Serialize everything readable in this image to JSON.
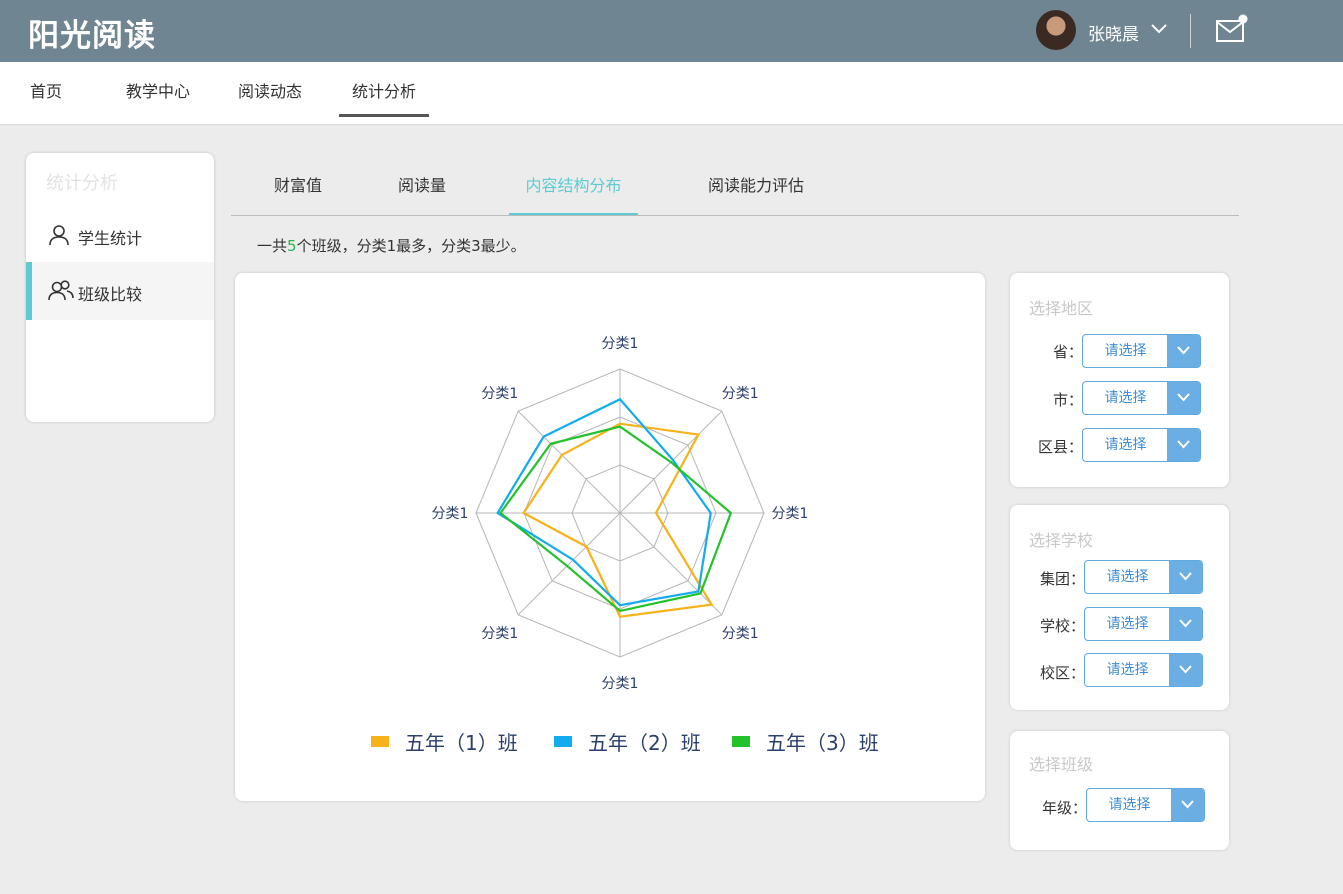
{
  "header": {
    "logo": "阳光阅读",
    "username": "张晓晨"
  },
  "nav": {
    "items": [
      {
        "label": "首页"
      },
      {
        "label": "教学中心"
      },
      {
        "label": "阅读动态"
      },
      {
        "label": "统计分析"
      }
    ],
    "active_index": 3
  },
  "sidebar": {
    "title": "统计分析",
    "items": [
      {
        "label": "学生统计",
        "icon": "user-icon"
      },
      {
        "label": "班级比较",
        "icon": "users-icon"
      }
    ],
    "active_index": 1
  },
  "tabs": {
    "items": [
      {
        "label": "财富值"
      },
      {
        "label": "阅读量"
      },
      {
        "label": "内容结构分布"
      },
      {
        "label": "阅读能力评估"
      }
    ],
    "active_index": 2
  },
  "summary": {
    "prefix": "一共",
    "count": "5",
    "suffix": "个班级，分类1最多，分类3最少。"
  },
  "chart_data": {
    "type": "radar",
    "axes": [
      "分类1",
      "分类1",
      "分类1",
      "分类1",
      "分类1",
      "分类1",
      "分类1",
      "分类1"
    ],
    "rmax": 100,
    "grid_levels": 3,
    "series": [
      {
        "name": "五年（1）班",
        "color": "#f7b218",
        "values": [
          62,
          77,
          25,
          90,
          72,
          33,
          67,
          57
        ]
      },
      {
        "name": "五年（2）班",
        "color": "#12acec",
        "values": [
          79,
          52,
          63,
          77,
          64,
          46,
          85,
          75
        ]
      },
      {
        "name": "五年（3）班",
        "color": "#22c32a",
        "values": [
          60,
          50,
          77,
          79,
          68,
          52,
          83,
          68
        ]
      }
    ]
  },
  "filters": {
    "region": {
      "title": "选择地区",
      "fields": [
        {
          "label": "省：",
          "value": "请选择"
        },
        {
          "label": "市：",
          "value": "请选择"
        },
        {
          "label": "区县：",
          "value": "请选择"
        }
      ]
    },
    "school": {
      "title": "选择学校",
      "fields": [
        {
          "label": "集团：",
          "value": "请选择"
        },
        {
          "label": "学校：",
          "value": "请选择"
        },
        {
          "label": "校区：",
          "value": "请选择"
        }
      ]
    },
    "class": {
      "title": "选择班级",
      "fields": [
        {
          "label": "年级：",
          "value": "请选择"
        }
      ]
    }
  }
}
